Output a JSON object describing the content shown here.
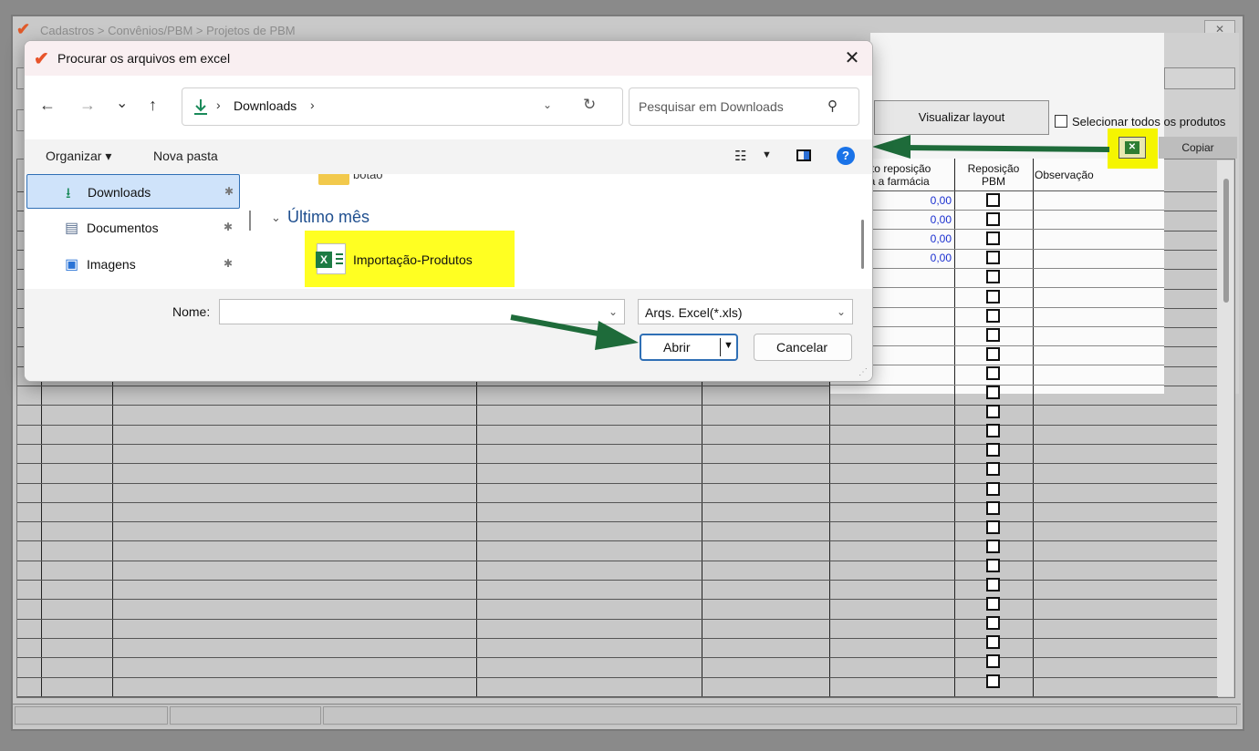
{
  "background": {
    "breadcrumb": "Cadastros > Convênios/PBM > Projetos de PBM",
    "close_label": "✕",
    "visualizar_layout": "Visualizar layout",
    "select_all_label": "Selecionar todos os produtos",
    "copiar_label": "Copiar",
    "excel_button_icon": "excel-icon",
    "grid": {
      "headers": {
        "ponto_reposicao": [
          "Ponto reposição",
          "para a farmácia"
        ],
        "reposicao_pbm": [
          "Reposição",
          "PBM"
        ],
        "observacao": "Observação"
      },
      "values": [
        "0,00",
        "0,00",
        "0,00",
        "0,00"
      ]
    }
  },
  "dialog": {
    "title": "Procurar os arquivos em excel",
    "close_label": "✕",
    "nav": {
      "back": "←",
      "forward": "→",
      "recent": "⌄",
      "up": "↑"
    },
    "address": {
      "separator": "›",
      "location": "Downloads",
      "dropdown": "⌄",
      "refresh": "↻"
    },
    "search": {
      "placeholder": "Pesquisar em Downloads",
      "icon": "⚲"
    },
    "commands": {
      "organizar": "Organizar ▾",
      "nova_pasta": "Nova pasta",
      "view_icon": "☷",
      "view_dropdown": "▼",
      "help": "?"
    },
    "nav_pane": {
      "items": [
        {
          "label": "Downloads",
          "icon": "download-icon",
          "glyph": "⭳",
          "pin": "📌"
        },
        {
          "label": "Documentos",
          "icon": "document-icon",
          "glyph": "▤",
          "pin": "📌"
        },
        {
          "label": "Imagens",
          "icon": "image-icon",
          "glyph": "▣",
          "pin": "📌"
        }
      ]
    },
    "files": {
      "folder_partial": "botão",
      "group_header": "Último mês",
      "group_chevron": "⌄",
      "file_name": "Importação-Produtos",
      "file_icon_letter": "X"
    },
    "footer": {
      "nome_label": "Nome:",
      "nome_value": "",
      "filter_value": "Arqs. Excel(*.xls)",
      "dropdown": "⌄",
      "abrir_label": "Abrir",
      "abrir_dd": "▼",
      "cancelar_label": "Cancelar"
    }
  },
  "colors": {
    "highlight": "#ffff22",
    "arrow": "#1e6b3a",
    "accent": "#2f6fb5",
    "value_blue": "#1a2fd0"
  }
}
